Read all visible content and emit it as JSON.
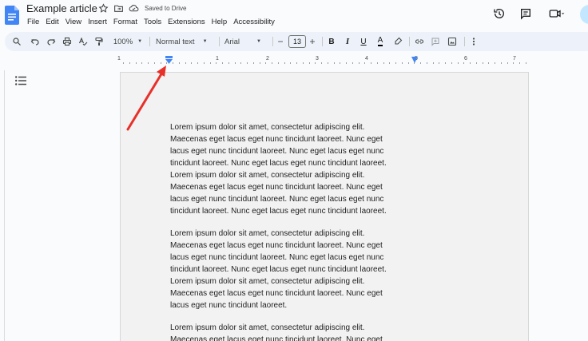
{
  "doc": {
    "title": "Example article",
    "saved_status": "Saved to Drive"
  },
  "menu": [
    "File",
    "Edit",
    "View",
    "Insert",
    "Format",
    "Tools",
    "Extensions",
    "Help",
    "Accessibility"
  ],
  "toolbar": {
    "zoom": "100%",
    "style": "Normal text",
    "font": "Arial",
    "font_size": "13",
    "minus": "−",
    "plus": "+",
    "bold": "B",
    "italic": "I",
    "underline": "U",
    "text_color": "A"
  },
  "ruler": {
    "numbers": [
      "1",
      "1",
      "2",
      "3",
      "4",
      "5",
      "6",
      "7"
    ]
  },
  "content": {
    "paragraphs": [
      "Lorem ipsum dolor sit amet, consectetur adipiscing elit.\nMaecenas eget lacus eget nunc tincidunt laoreet. Nunc eget\nlacus eget nunc tincidunt laoreet. Nunc eget lacus eget nunc\ntincidunt laoreet. Nunc eget lacus eget nunc tincidunt laoreet.\nLorem ipsum dolor sit amet, consectetur adipiscing elit.\nMaecenas eget lacus eget nunc tincidunt laoreet. Nunc eget\nlacus eget nunc tincidunt laoreet. Nunc eget lacus eget nunc\ntincidunt laoreet. Nunc eget lacus eget nunc tincidunt laoreet.",
      "Lorem ipsum dolor sit amet, consectetur adipiscing elit.\nMaecenas eget lacus eget nunc tincidunt laoreet. Nunc eget\nlacus eget nunc tincidunt laoreet. Nunc eget lacus eget nunc\ntincidunt laoreet. Nunc eget lacus eget nunc tincidunt laoreet.\nLorem ipsum dolor sit amet, consectetur adipiscing elit.\nMaecenas eget lacus eget nunc tincidunt laoreet. Nunc eget\nlacus eget nunc tincidunt laoreet.",
      "Lorem ipsum dolor sit amet, consectetur adipiscing elit.\nMaecenas eget lacus eget nunc tincidunt laoreet. Nunc eget"
    ]
  },
  "colors": {
    "docs_blue": "#4285f4",
    "toolbar_bg": "#edf2fa",
    "annotation_arrow": "#e8302a",
    "indent_marker": "#4285f4"
  },
  "icons": [
    "docs-logo-icon",
    "star-icon",
    "move-folder-icon",
    "cloud-saved-icon",
    "history-icon",
    "comment-icon",
    "meet-icon",
    "search-icon",
    "undo-icon",
    "redo-icon",
    "print-icon",
    "spellcheck-icon",
    "paint-format-icon",
    "highlighter-icon",
    "link-icon",
    "add-comment-icon",
    "image-icon",
    "more-icon",
    "outline-icon",
    "indent-marker-icon"
  ]
}
